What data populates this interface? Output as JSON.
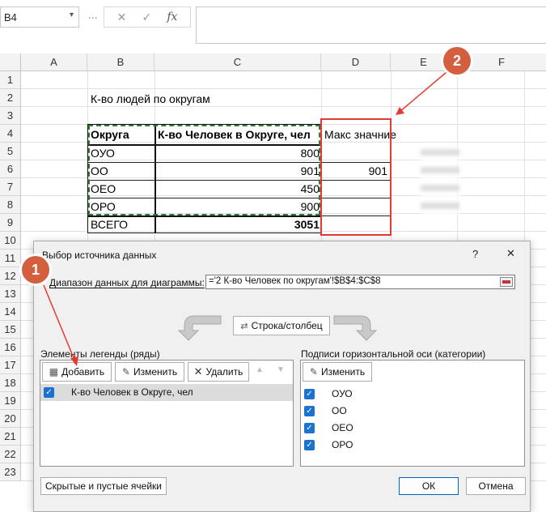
{
  "formula_bar": {
    "name_box": "B4",
    "cancel_icon": "✕",
    "confirm_icon": "✓",
    "fx_icon": "fx",
    "formula": ""
  },
  "columns": [
    "A",
    "B",
    "C",
    "D",
    "E",
    "F"
  ],
  "rows": [
    "1",
    "2",
    "3",
    "4",
    "5",
    "6",
    "7",
    "8",
    "9",
    "10",
    "11",
    "12",
    "13",
    "14",
    "15",
    "16",
    "17",
    "18",
    "19",
    "20",
    "21",
    "22",
    "23"
  ],
  "sheet": {
    "title": "К-во людей по округам",
    "headers": [
      "Округа",
      "К-во Человек в Округе, чел",
      "Макс значние"
    ],
    "data_rows": [
      {
        "district": "ОУО",
        "count": "800",
        "max": ""
      },
      {
        "district": "ОО",
        "count": "901",
        "max": "901"
      },
      {
        "district": "ОЕО",
        "count": "450",
        "max": ""
      },
      {
        "district": "ОРО",
        "count": "900",
        "max": ""
      }
    ],
    "total_label": "ВСЕГО",
    "total_value": "3051"
  },
  "callouts": {
    "one": "1",
    "two": "2"
  },
  "dialog": {
    "title": "Выбор источника данных",
    "help": "?",
    "close": "✕",
    "range_label": "Диапазон данных для диаграммы:",
    "range_value": "='2 К-во Человек по округам'!$B$4:$C$8",
    "switch_button": "Строка/столбец",
    "legend_label": "Элементы легенды (ряды)",
    "add_button": "Добавить",
    "edit_button": "Изменить",
    "delete_button": "Удалить",
    "series": [
      "К-во Человек в Округе, чел"
    ],
    "axis_label": "Подписи горизонтальной оси (категории)",
    "axis_edit_button": "Изменить",
    "categories": [
      "ОУО",
      "ОО",
      "ОЕО",
      "ОРО"
    ],
    "hidden_button": "Скрытые и пустые ячейки",
    "ok_button": "ОК",
    "cancel_button": "Отмена"
  },
  "colors": {
    "accent": "#1a73d0",
    "callout": "#d35f3e",
    "highlight": "#e53935",
    "marching_ants": "#2e7d32"
  }
}
